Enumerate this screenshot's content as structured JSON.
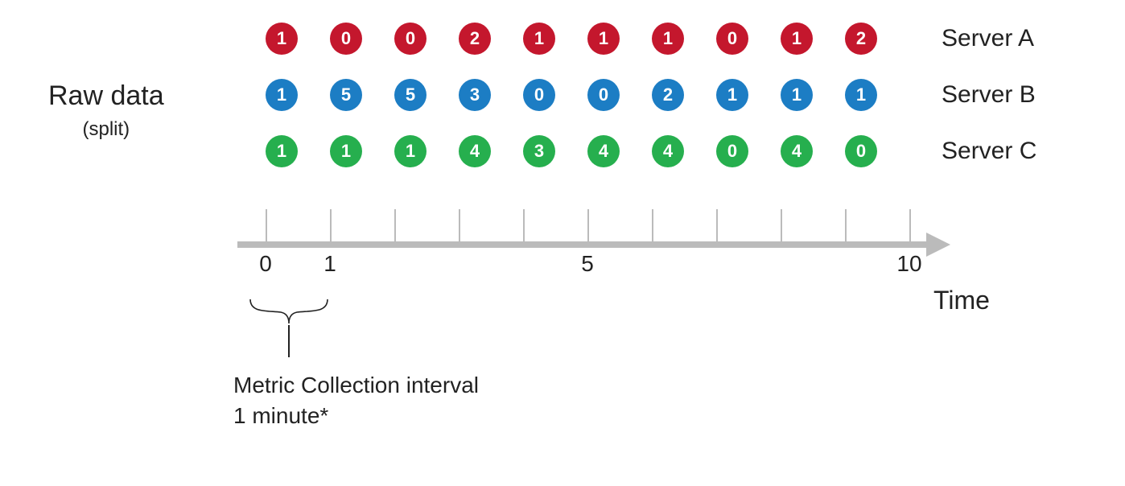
{
  "left_label": {
    "title": "Raw data",
    "subtitle": "(split)"
  },
  "colors": {
    "a": "#c4172d",
    "b": "#1c7dc4",
    "c": "#26af4e"
  },
  "chart_data": {
    "type": "table",
    "title": "Raw data (split)",
    "xlabel": "Time",
    "ylabel": "",
    "x": [
      0,
      1,
      2,
      3,
      4,
      5,
      6,
      7,
      8,
      9
    ],
    "series": [
      {
        "name": "Server A",
        "values": [
          1,
          0,
          0,
          2,
          1,
          1,
          1,
          0,
          1,
          2
        ]
      },
      {
        "name": "Server B",
        "values": [
          1,
          5,
          5,
          3,
          0,
          0,
          2,
          1,
          1,
          1
        ]
      },
      {
        "name": "Server C",
        "values": [
          1,
          1,
          1,
          4,
          3,
          4,
          4,
          0,
          4,
          0
        ]
      }
    ],
    "ticks_shown": [
      {
        "pos": 0,
        "label": "0"
      },
      {
        "pos": 1,
        "label": "1"
      },
      {
        "pos": 5,
        "label": "5"
      },
      {
        "pos": 10,
        "label": "10"
      }
    ]
  },
  "time_label": "Time",
  "annotation": {
    "line1": "Metric Collection interval",
    "line2": "1 minute*"
  }
}
